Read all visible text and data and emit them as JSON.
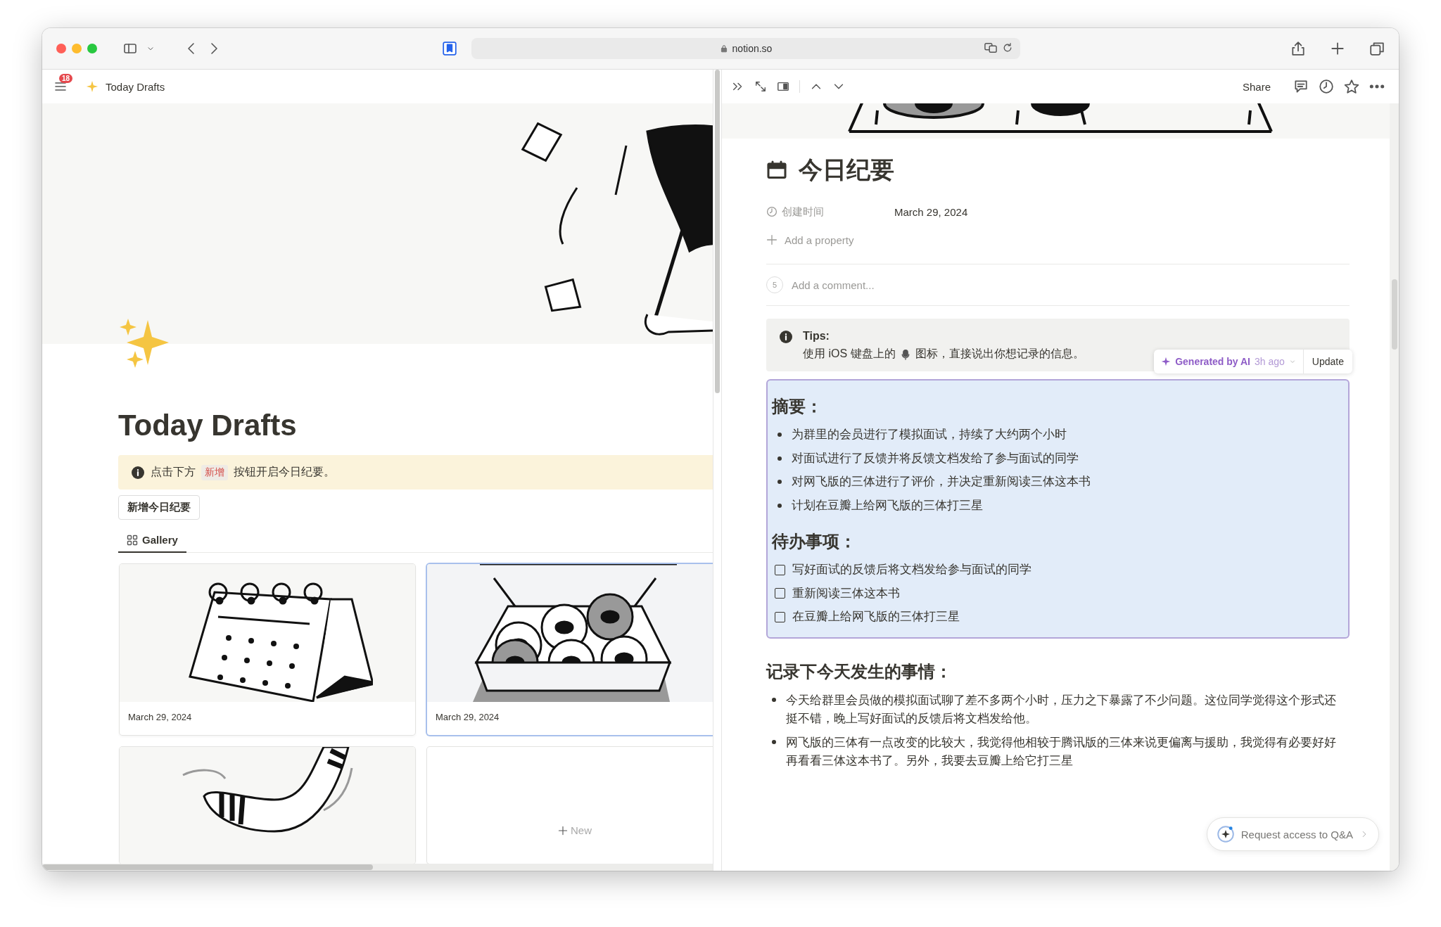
{
  "browser": {
    "url": "notion.so"
  },
  "left": {
    "notification_count": "18",
    "breadcrumb": "Today Drafts",
    "title": "Today Drafts",
    "callout": {
      "before": "点击下方",
      "tag": "新增",
      "after": "按钮开启今日纪要。"
    },
    "new_button": "新增今日纪要",
    "views": [
      {
        "label": "Gallery",
        "selected": true
      }
    ],
    "cards": [
      {
        "kind": "calendar",
        "date": "March 29, 2024",
        "selected": false
      },
      {
        "kind": "donuts",
        "date": "March 29, 2024",
        "selected": true
      },
      {
        "kind": "boomerang",
        "selected": false
      },
      {
        "kind": "new",
        "label": "New",
        "selected": false
      }
    ]
  },
  "right": {
    "share": "Share",
    "title": "今日纪要",
    "properties": [
      {
        "name": "创建时间",
        "value": "March 29, 2024"
      }
    ],
    "add_property": "Add a property",
    "comment": {
      "count": "5",
      "placeholder": "Add a comment..."
    },
    "tips": {
      "title": "Tips:",
      "before": "使用 iOS 键盘上的",
      "after": "图标，直接说出你想记录的信息。"
    },
    "ai": {
      "label": "Generated by AI",
      "time": "3h ago",
      "update": "Update"
    },
    "ai_sections": [
      {
        "kind": "bullets",
        "heading": "摘要：",
        "items": [
          {
            "text": "为群里的会员进行了模拟面试，持续了大约两个小时"
          },
          {
            "text": "对面试进行了反馈并将反馈文档发给了参与面试的同学"
          },
          {
            "text": "对网飞版的三体进行了评价，并决定重新阅读三体这本书"
          },
          {
            "text": "计划在豆瓣上给网飞版的三体打三星"
          }
        ]
      },
      {
        "kind": "todos",
        "heading": "待办事项：",
        "items": [
          {
            "text": "写好面试的反馈后将文档发给参与面试的同学",
            "checked": false
          },
          {
            "text": "重新阅读三体这本书",
            "checked": false
          },
          {
            "text": "在豆瓣上给网飞版的三体打三星",
            "checked": false
          }
        ]
      }
    ],
    "notes": {
      "heading": "记录下今天发生的事情：",
      "items": [
        "今天给群里会员做的模拟面试聊了差不多两个小时，压力之下暴露了不少问题。这位同学觉得这个形式还挺不错，晚上写好面试的反馈后将文档发给他。",
        "网飞版的三体有一点改变的比较大，我觉得他相较于腾讯版的三体来说更偏离与援助，我觉得有必要好好再看看三体这本书了。另外，我要去豆瓣上给它打三星"
      ]
    },
    "qa_button": "Request access to Q&A"
  }
}
